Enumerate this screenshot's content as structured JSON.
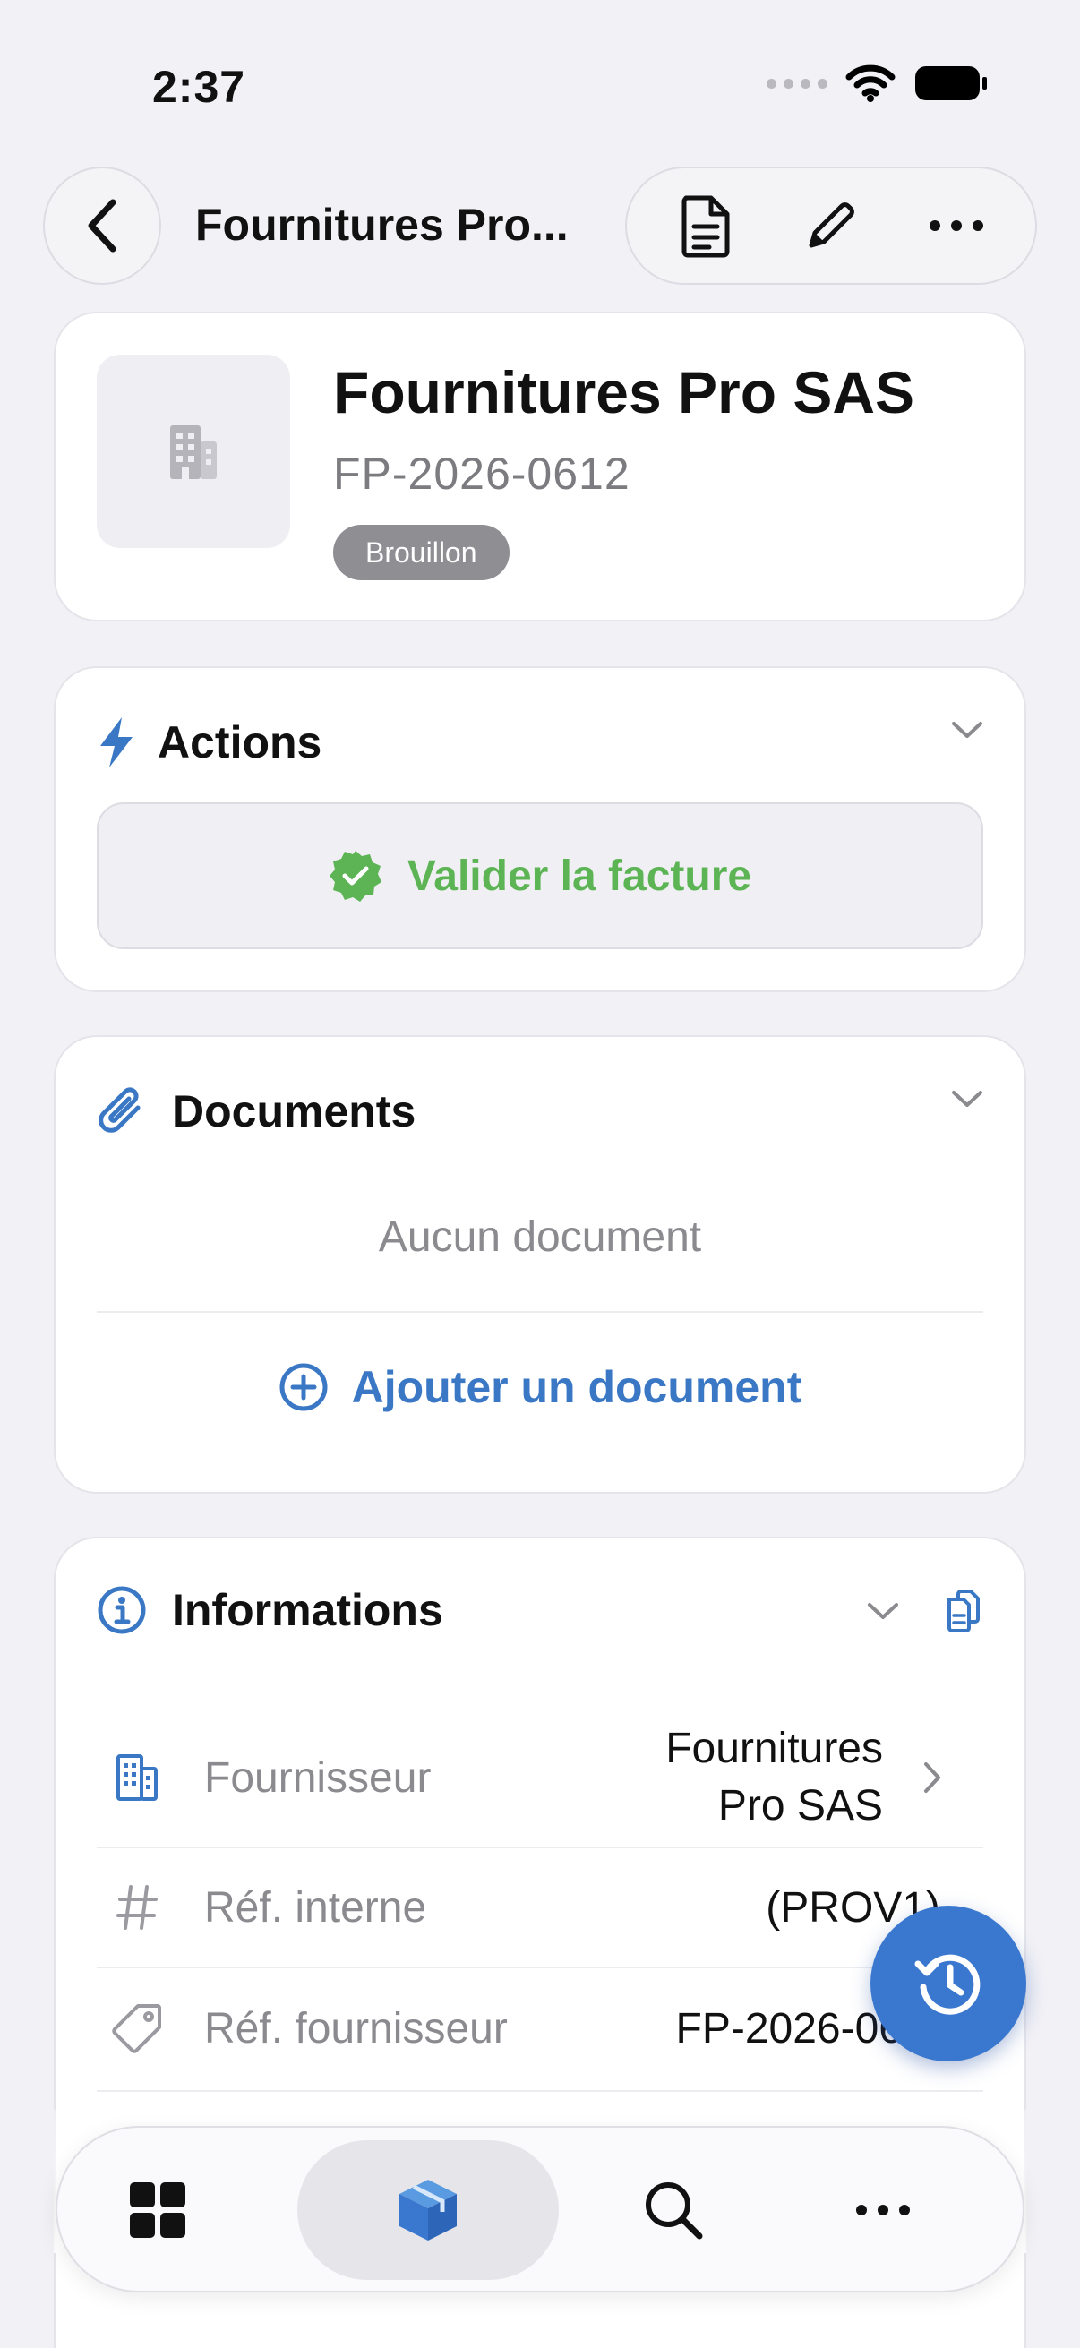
{
  "status_bar": {
    "time": "2:37"
  },
  "nav": {
    "title": "Fournitures Pro...",
    "back_icon": "chevron-left-icon",
    "actions": [
      "document-icon",
      "pencil-icon",
      "ellipsis-icon"
    ]
  },
  "header": {
    "supplier_name": "Fournitures Pro SAS",
    "invoice_ref": "FP-2026-0612",
    "status": "Brouillon",
    "avatar_icon": "building-icon"
  },
  "actions_section": {
    "title": "Actions",
    "validate_label": "Valider la facture"
  },
  "documents_section": {
    "title": "Documents",
    "empty_text": "Aucun document",
    "add_label": "Ajouter un document"
  },
  "info_section": {
    "title": "Informations",
    "rows": [
      {
        "label": "Fournisseur",
        "value_line1": "Fournitures",
        "value_line2": "Pro SAS",
        "icon": "building-icon"
      },
      {
        "label": "Réf. interne",
        "value": "(PROV1)",
        "icon": "hash-icon"
      },
      {
        "label": "Réf. fournisseur",
        "value": "FP-2026-06",
        "icon": "tag-icon"
      }
    ]
  },
  "tabbar": {
    "tabs": [
      "grid-icon",
      "box-icon",
      "search-icon",
      "ellipsis-icon"
    ],
    "active": "box-icon"
  },
  "colors": {
    "accent": "#3a78c5",
    "success": "#5cb454",
    "badge": "#8e8e93",
    "background": "#f1f1f6"
  }
}
